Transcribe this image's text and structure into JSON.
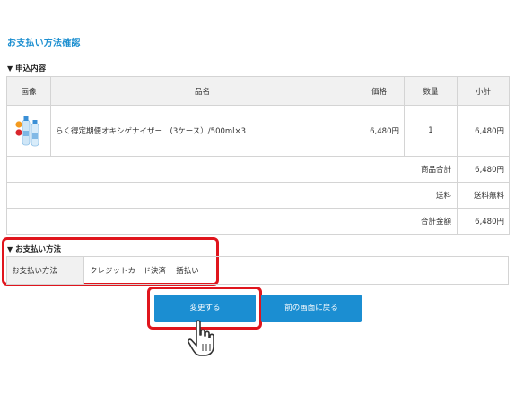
{
  "page": {
    "title": "お支払い方法確認"
  },
  "order": {
    "heading": "申込内容",
    "headers": {
      "image": "画像",
      "name": "品名",
      "price": "価格",
      "qty": "数量",
      "subtotal": "小計"
    },
    "item": {
      "name": "らく得定期便オキシゲナイザー　(3ケース）/500ml×3",
      "price": "6,480円",
      "qty": "1",
      "subtotal": "6,480円",
      "image_icon": "water-bottles-icon"
    },
    "summary": [
      {
        "label": "商品合計",
        "value": "6,480円"
      },
      {
        "label": "送料",
        "value": "送料無料"
      },
      {
        "label": "合計金額",
        "value": "6,480円"
      }
    ]
  },
  "payment": {
    "heading": "お支払い方法",
    "label": "お支払い方法",
    "value": "クレジットカード決済 一括払い"
  },
  "buttons": {
    "change": "変更する",
    "back": "前の画面に戻る"
  },
  "colors": {
    "accent": "#1b8ed2",
    "title": "#1d8fd0",
    "highlight": "#e0151d",
    "header_bg": "#f1f1f1",
    "border": "#d4d4d4"
  },
  "icons": {
    "pointer": "hand-pointer-icon",
    "triangle": "triangle-down-icon"
  }
}
